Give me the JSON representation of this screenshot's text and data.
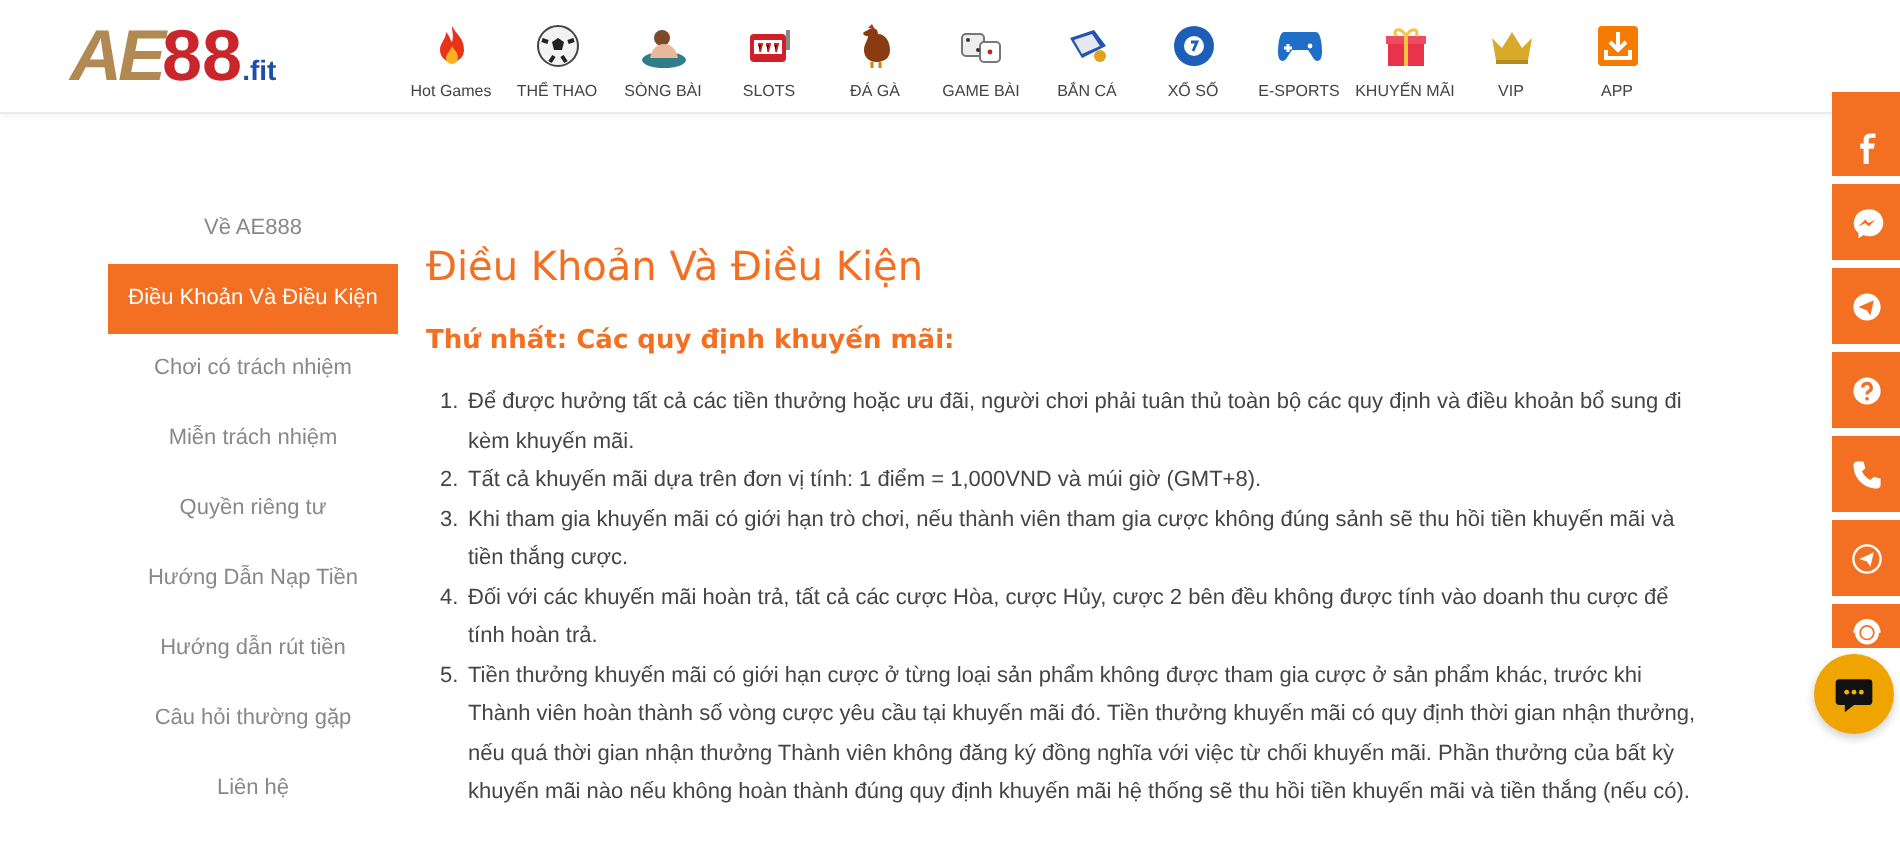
{
  "logo": {
    "main": "AE",
    "accent": "88",
    "suffix": ".fit"
  },
  "nav": [
    {
      "label": "Hot Games"
    },
    {
      "label": "THỂ THAO"
    },
    {
      "label": "SÒNG BÀI"
    },
    {
      "label": "SLOTS"
    },
    {
      "label": "ĐÁ GÀ"
    },
    {
      "label": "GAME BÀI"
    },
    {
      "label": "BẮN CÁ"
    },
    {
      "label": "XỔ SỐ"
    },
    {
      "label": "E-SPORTS"
    },
    {
      "label": "KHUYẾN MÃI"
    },
    {
      "label": "VIP"
    },
    {
      "label": "APP"
    }
  ],
  "sidebar": {
    "items": [
      {
        "label": "Về AE888",
        "selected": false
      },
      {
        "label": "Điều Khoản Và Điều Kiện",
        "selected": true
      },
      {
        "label": "Chơi có trách nhiệm",
        "selected": false
      },
      {
        "label": "Miễn trách nhiệm",
        "selected": false
      },
      {
        "label": "Quyền riêng tư",
        "selected": false
      },
      {
        "label": "Hướng Dẫn Nạp Tiền",
        "selected": false
      },
      {
        "label": "Hướng dẫn rút tiền",
        "selected": false
      },
      {
        "label": "Câu hỏi thường gặp",
        "selected": false
      },
      {
        "label": "Liên hệ",
        "selected": false
      }
    ]
  },
  "article": {
    "title": "Điều Khoản Và Điều Kiện",
    "section_title": "Thứ nhất: Các quy định khuyến mãi:",
    "items": [
      {
        "marker": "1.",
        "text": "Để được hưởng tất cả các tiền thưởng hoặc ưu đãi, người chơi phải tuân thủ toàn bộ các quy định và điều khoản bổ sung đi kèm khuyến mãi."
      },
      {
        "marker": "2.",
        "text": "Tất cả khuyến mãi dựa trên đơn vị tính: 1 điểm = 1,000VND và múi giờ (GMT+8)."
      },
      {
        "marker": "3.",
        "text": "Khi tham gia khuyến mãi có giới hạn trò chơi, nếu thành viên tham gia cược không đúng sảnh sẽ thu hồi tiền khuyến mãi và tiền thắng cược."
      },
      {
        "marker": "4.",
        "text": "Đối với các khuyến mãi hoàn trả, tất cả các cược Hòa, cược Hủy, cược 2 bên đều không được tính vào doanh thu cược để tính hoàn trả."
      },
      {
        "marker": "5.",
        "text": "Tiền thưởng khuyến mãi có giới hạn cược ở từng loại sản phẩm không được tham gia cược ở sản phẩm khác, trước khi Thành viên hoàn thành số vòng cược yêu cầu tại khuyến mãi đó. Tiền thưởng khuyến mãi có quy định thời gian nhận thưởng, nếu quá thời gian nhận thưởng Thành viên không đăng ký đồng nghĩa với việc từ chối khuyến mãi. Phần thưởng của bất kỳ khuyến mãi nào nếu không hoàn thành đúng quy định khuyến mãi hệ thống sẽ thu hồi tiền khuyến mãi và tiền thắng (nếu có)."
      }
    ]
  }
}
